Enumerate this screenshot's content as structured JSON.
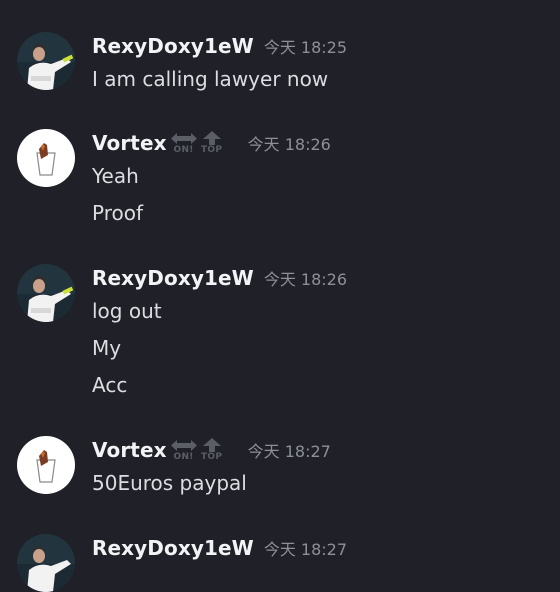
{
  "messages": [
    {
      "author": "RexyDoxy1eW",
      "avatar_icon": "soccer-player-avatar",
      "timestamp": "今天 18:25",
      "lines": [
        "I am calling lawyer now"
      ]
    },
    {
      "author": "Vortex",
      "avatar_icon": "cup-avatar",
      "badges": [
        "ON!",
        "TOP"
      ],
      "timestamp": "今天 18:26",
      "lines": [
        "Yeah",
        "Proof"
      ]
    },
    {
      "author": "RexyDoxy1eW",
      "avatar_icon": "soccer-player-avatar",
      "timestamp": "今天 18:26",
      "lines": [
        "log out",
        "My",
        "Acc"
      ]
    },
    {
      "author": "Vortex",
      "avatar_icon": "cup-avatar",
      "badges": [
        "ON!",
        "TOP"
      ],
      "timestamp": "今天 18:27",
      "lines": [
        "50Euros paypal"
      ]
    },
    {
      "author": "RexyDoxy1eW",
      "avatar_icon": "soccer-player-avatar",
      "timestamp": "今天 18:27",
      "lines": []
    }
  ]
}
